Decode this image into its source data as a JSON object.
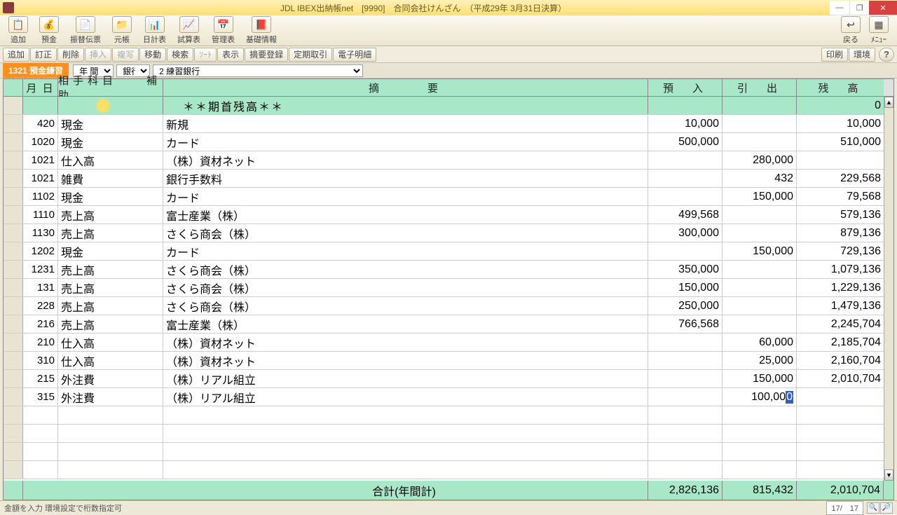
{
  "title": "JDL IBEX出納帳net　[9990]　合同会社けんざん　（平成29年 3月31日決算）",
  "toolbar": [
    {
      "label": "追加",
      "icon": "📋"
    },
    {
      "label": "預金",
      "icon": "💰"
    },
    {
      "label": "振替伝票",
      "icon": "📄"
    },
    {
      "label": "元帳",
      "icon": "📁"
    },
    {
      "label": "日計表",
      "icon": "📊"
    },
    {
      "label": "試算表",
      "icon": "📈"
    },
    {
      "label": "管理表",
      "icon": "📅"
    },
    {
      "label": "基礎情報",
      "icon": "📕"
    }
  ],
  "toolbar_right": [
    {
      "label": "戻る",
      "icon": "↩"
    },
    {
      "label": "ﾒﾆｭｰ",
      "icon": "▦"
    }
  ],
  "commands": [
    "追加",
    "訂正",
    "削除",
    "挿入",
    "複写",
    "移動",
    "検索",
    "ｿｰﾄ",
    "表示",
    "摘要登録",
    "定期取引",
    "電子明細"
  ],
  "commands_right": [
    "印刷",
    "環境"
  ],
  "account": {
    "code": "1321",
    "name": "預金練習"
  },
  "period_select": "年 間",
  "bank_label": "銀行",
  "bank_select": "2 練習銀行",
  "headers": {
    "date": "月 日",
    "acct": "相手科目　　補助",
    "memo": "摘　　　要",
    "dep": "預　入",
    "wd": "引　出",
    "bal": "残　高"
  },
  "opening_label": "＊＊期首残高＊＊",
  "opening_balance": "0",
  "rows": [
    {
      "date": "420",
      "acct": "現金",
      "memo": "新規",
      "dep": "10,000",
      "wd": "",
      "bal": "10,000"
    },
    {
      "date": "1020",
      "acct": "現金",
      "memo": "カード",
      "dep": "500,000",
      "wd": "",
      "bal": "510,000"
    },
    {
      "date": "1021",
      "acct": "仕入高",
      "memo": "（株）資材ネット",
      "dep": "",
      "wd": "280,000",
      "bal": ""
    },
    {
      "date": "1021",
      "acct": "雑費",
      "memo": "銀行手数料",
      "dep": "",
      "wd": "432",
      "bal": "229,568"
    },
    {
      "date": "1102",
      "acct": "現金",
      "memo": "カード",
      "dep": "",
      "wd": "150,000",
      "bal": "79,568"
    },
    {
      "date": "1110",
      "acct": "売上高",
      "memo": "富士産業（株）",
      "dep": "499,568",
      "wd": "",
      "bal": "579,136"
    },
    {
      "date": "1130",
      "acct": "売上高",
      "memo": "さくら商会（株）",
      "dep": "300,000",
      "wd": "",
      "bal": "879,136"
    },
    {
      "date": "1202",
      "acct": "現金",
      "memo": "カード",
      "dep": "",
      "wd": "150,000",
      "bal": "729,136"
    },
    {
      "date": "1231",
      "acct": "売上高",
      "memo": "さくら商会（株）",
      "dep": "350,000",
      "wd": "",
      "bal": "1,079,136"
    },
    {
      "date": "131",
      "acct": "売上高",
      "memo": "さくら商会（株）",
      "dep": "150,000",
      "wd": "",
      "bal": "1,229,136"
    },
    {
      "date": "228",
      "acct": "売上高",
      "memo": "さくら商会（株）",
      "dep": "250,000",
      "wd": "",
      "bal": "1,479,136"
    },
    {
      "date": "216",
      "acct": "売上高",
      "memo": "富士産業（株）",
      "dep": "766,568",
      "wd": "",
      "bal": "2,245,704"
    },
    {
      "date": "210",
      "acct": "仕入高",
      "memo": "（株）資材ネット",
      "dep": "",
      "wd": "60,000",
      "bal": "2,185,704"
    },
    {
      "date": "310",
      "acct": "仕入高",
      "memo": "（株）資材ネット",
      "dep": "",
      "wd": "25,000",
      "bal": "2,160,704"
    },
    {
      "date": "215",
      "acct": "外注費",
      "memo": "（株）リアル組立",
      "dep": "",
      "wd": "150,000",
      "bal": "2,010,704"
    },
    {
      "date": "315",
      "acct": "外注費",
      "memo": "（株）リアル組立",
      "dep": "",
      "wd": "100,000",
      "bal": "",
      "editing": true
    }
  ],
  "totals": {
    "label": "合計(年間計)",
    "dep": "2,826,136",
    "wd": "815,432",
    "bal": "2,010,704"
  },
  "status_left": "金額を入力 環境設定で桁数指定可",
  "page_indicator": "17/　17"
}
